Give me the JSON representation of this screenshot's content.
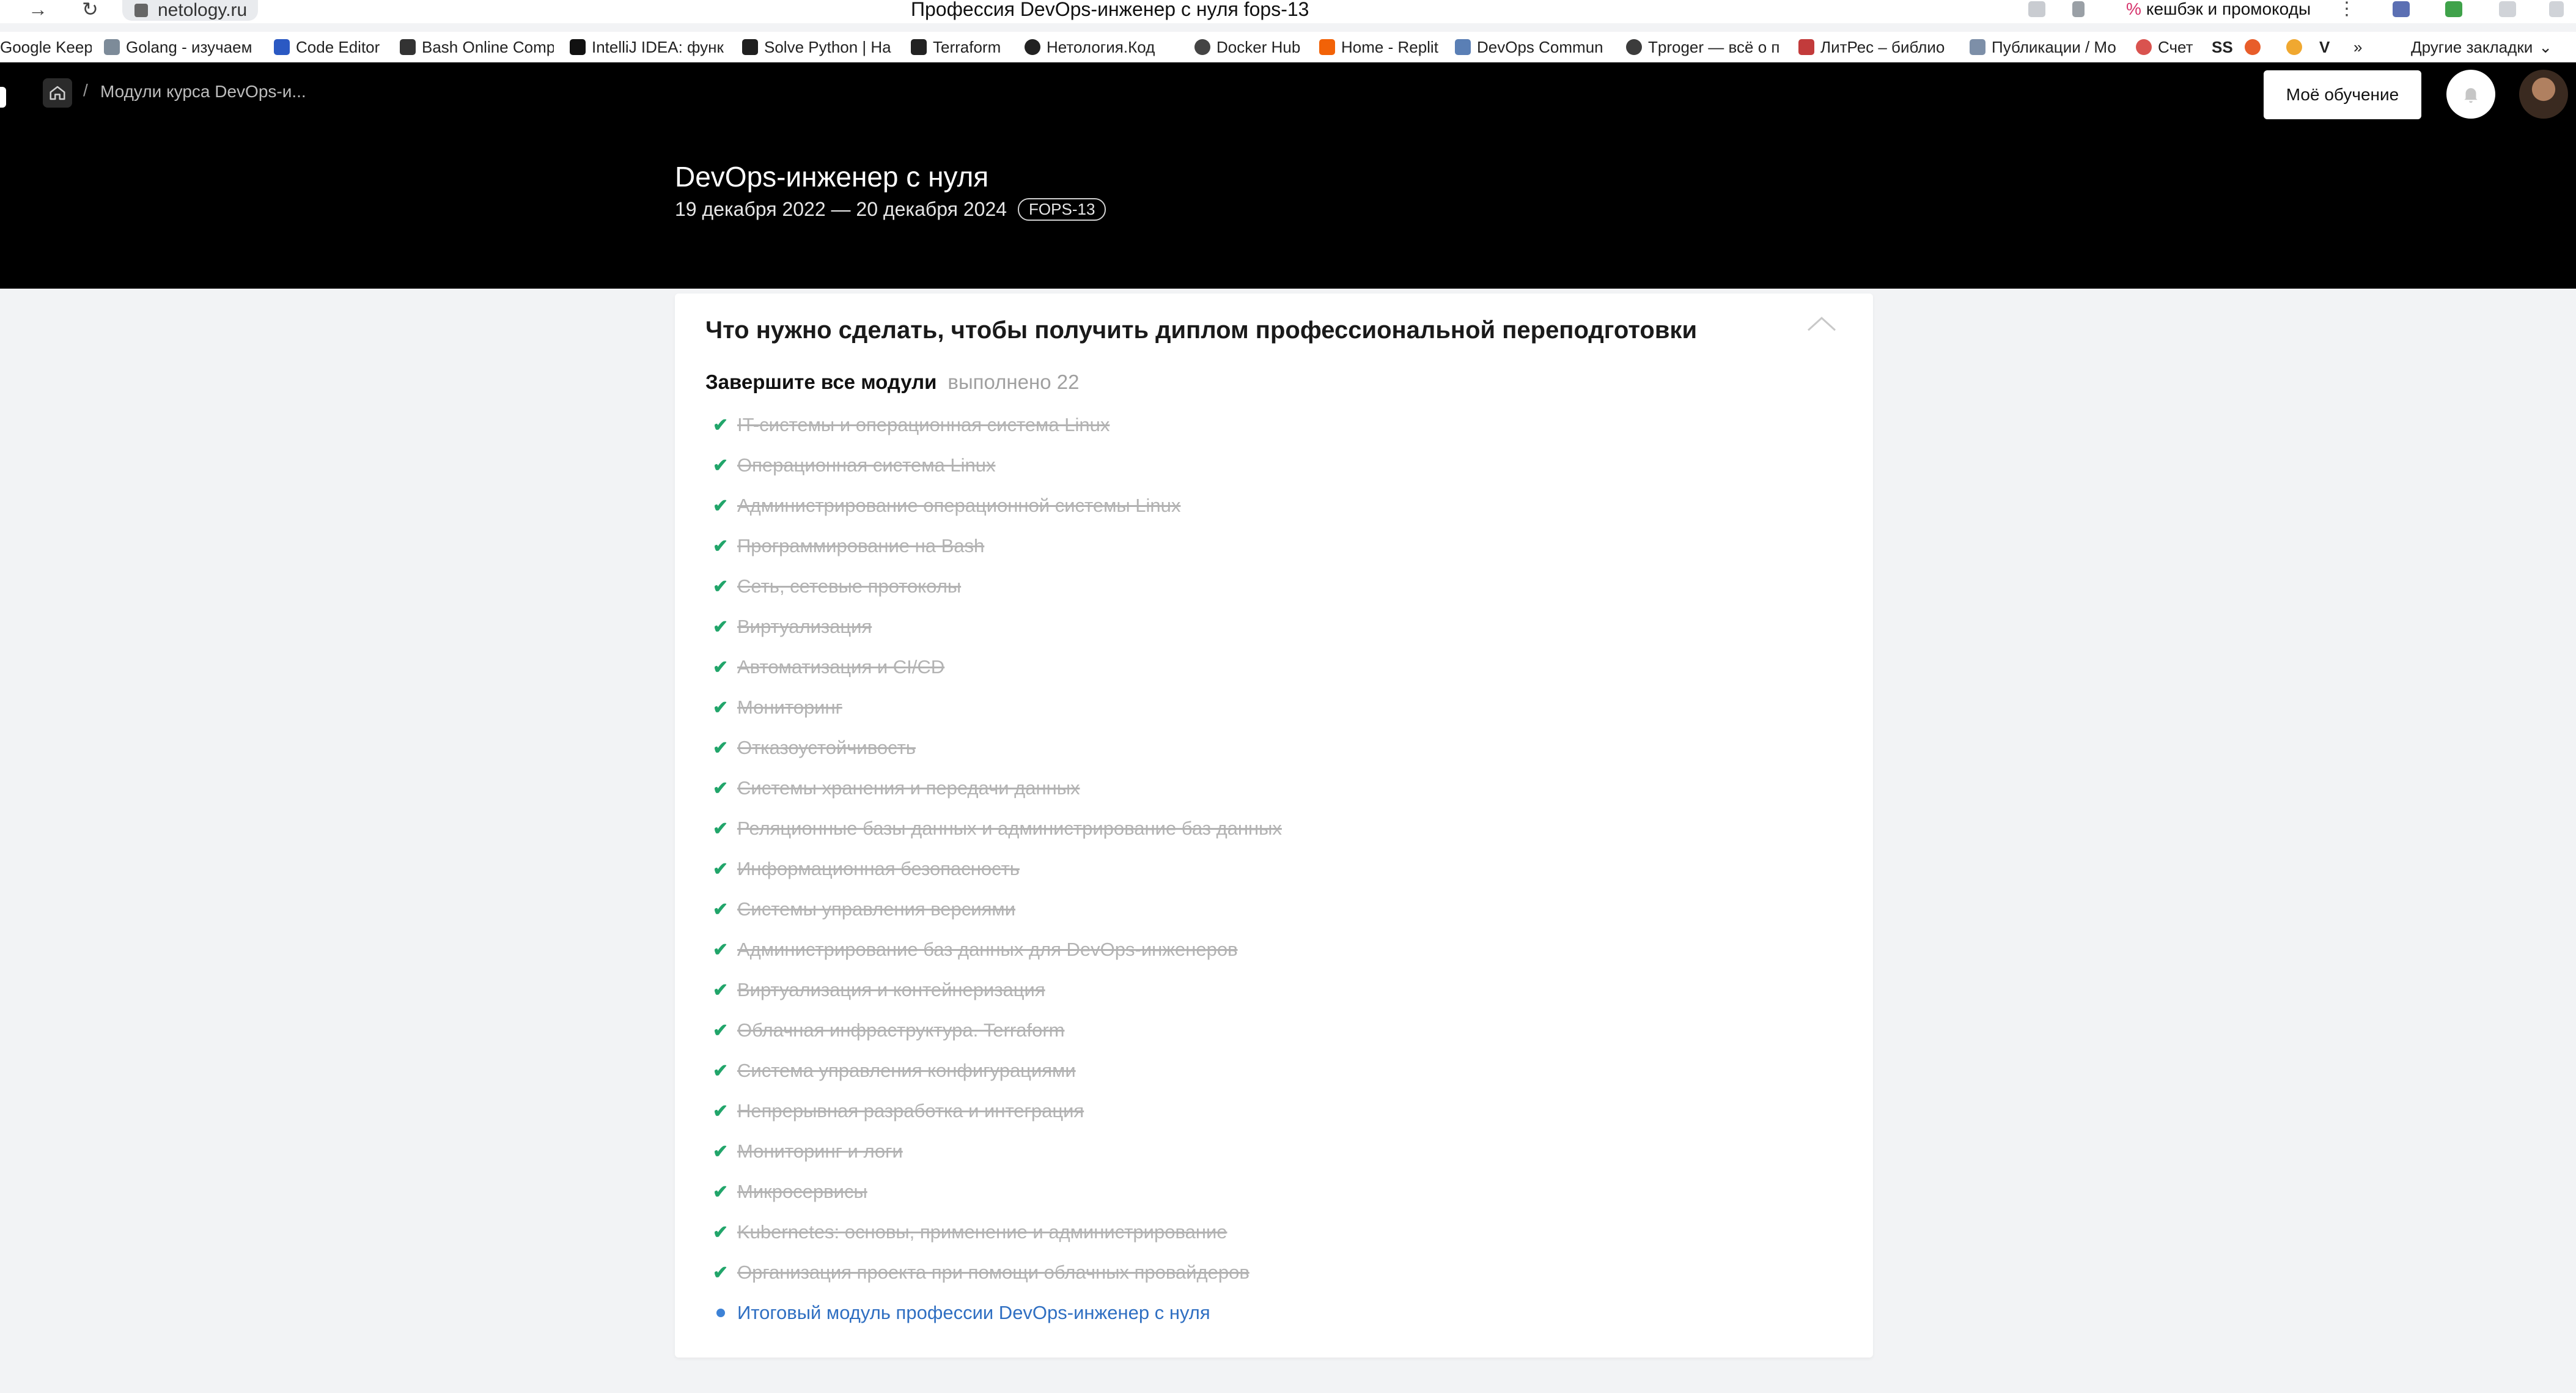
{
  "browser": {
    "nav_back": "→",
    "nav_reload": "↻",
    "url": "netology.ru",
    "window_title": "Профессия DevOps-инженер с нуля fops-13",
    "extension_tab": "кешбэк и промокоды",
    "extension_tab_mark": "%",
    "menu_glyph": "⋮",
    "bookmarks": [
      "Google Keep",
      "Golang - изучаем",
      "Code Editor",
      "Bash Online Comp",
      "IntelliJ IDEA: функ",
      "Solve Python | Ha",
      "Terraform",
      "Нетология.Код",
      "Docker Hub",
      "Home - Replit",
      "DevOps Commun",
      "Tproger — всё о п",
      "ЛитРес – библио",
      "Публикации / Мо",
      "Счет",
      "SS",
      "V"
    ],
    "bookmarks_more": "»",
    "other_bookmarks": "Другие закладки"
  },
  "header": {
    "breadcrumb": "Модули курса DevOps-и...",
    "breadcrumb_sep": "/",
    "my_learning_label": "Моё обучение",
    "course_title": "DevOps-инженер с нуля",
    "course_dates": "19 декабря 2022 — 20 декабря 2024",
    "course_code": "FOPS-13"
  },
  "card": {
    "title": "Что нужно сделать, чтобы получить диплом профессиональной переподготовки",
    "modules_label": "Завершите все модули",
    "modules_count": "выполнено 22",
    "completed_modules": [
      "IT-системы и операционная система Linux",
      "Операционная система Linux",
      "Администрирование операционной системы Linux",
      "Программирование на Bash",
      "Сеть, сетевые протоколы",
      "Виртуализация",
      "Автоматизация и CI/CD",
      "Мониторинг",
      "Отказоустойчивость",
      "Системы хранения и передачи данных",
      "Реляционные базы данных и администрирование баз данных",
      "Информационная безопасность",
      "Системы управления версиями",
      "Администрирование баз данных для DevOps-инженеров",
      "Виртуализация и контейнеризация",
      "Облачная инфраструктура. Terraform",
      "Система управления конфигурациями",
      "Непрерывная разработка и интеграция",
      "Мониторинг и логи",
      "Микросервисы",
      "Kubernetes: основы, применение и администрирование",
      "Организация проекта при помощи облачных провайдеров"
    ],
    "current_module": "Итоговый модуль профессии DevOps-инженер с нуля"
  },
  "colors": {
    "header_bg": "#000000",
    "page_bg": "#f2f3f5",
    "check": "#21a56a",
    "current_link": "#2f6fc2",
    "completed_text": "#b3b3b3"
  }
}
